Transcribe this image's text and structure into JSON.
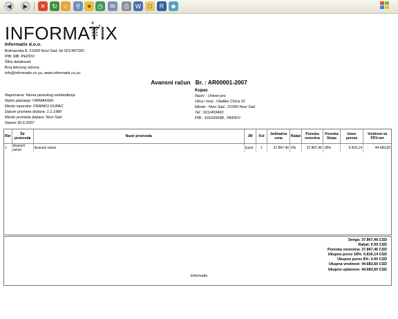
{
  "toolbar": {
    "buttons": [
      "back-icon",
      "forward-icon",
      "stop-icon",
      "refresh-icon",
      "home-icon",
      "search-icon",
      "favorites-icon",
      "history-icon",
      "mail-icon",
      "print-icon",
      "edit-icon",
      "discuss-icon",
      "research-icon",
      "messenger-icon"
    ]
  },
  "company": {
    "logo_text": "INFORMATIX",
    "name": "Informatix d.o.o.",
    "lines": [
      "Bolmanska 8, 21000 Novi Sad, tel 021/467281",
      "PIB:  MB:   PEPDV:",
      "Šifra delatnosti:",
      "Broj tekućeg računa",
      "info@informatix.co.yu, www.informatix.co.yu"
    ]
  },
  "doc": {
    "title": "Avansni račun   Br. : AR00001-2007"
  },
  "left_info": [
    "Napomena: Nema poreskog oslobođenja",
    "Način plaćanja: VIRMANSKI",
    "Mesto isporuke: FRANKO KUPAC",
    "Datum prometa dobara: 1.1.1980",
    "Mesto prometa dobara: Novi Sad",
    "Datum 30.6.2007"
  ],
  "kupac": {
    "heading": "Kupac",
    "lines": [
      "Naziv : Univer-pro",
      "Ulica i broj : Vladike Ćirića 31",
      "Mesto : Novi Sad , 21000 Novi Sad",
      "Tel : 021/493460",
      "PIB : 101695698 , PEPDV:"
    ]
  },
  "table": {
    "headers": [
      "Rbr",
      "Šir proizvoda",
      "Naziv proizvoda",
      "JM",
      "Kol",
      "Jedinačna cena",
      "Rabat",
      "Poreska osnovica",
      "Poreska Stopa",
      "Iznos poreza",
      "Vrednost sa PDV-om"
    ],
    "rows": [
      [
        "1",
        "Avansni račun",
        "Avansni račun",
        "Each",
        "1",
        "37.867,46",
        "0%",
        "37.867,46",
        "18%",
        "6.816,14",
        "44.683,60"
      ]
    ]
  },
  "totals": [
    "Svega: 37.867,46 CSD",
    "Rabat: 0.00 CSD",
    "Poreska osnovica: 37.867,46 CSD",
    "Ukupno porez 18%: 6.816,14 CSD",
    "Ukupno porez 8%: 0.00 CSD",
    "Ukupna vrednost: 44.683,60 CSD",
    "Ukupno uplaćeno: 44.683,60 CSD"
  ],
  "footer": "Informatix"
}
